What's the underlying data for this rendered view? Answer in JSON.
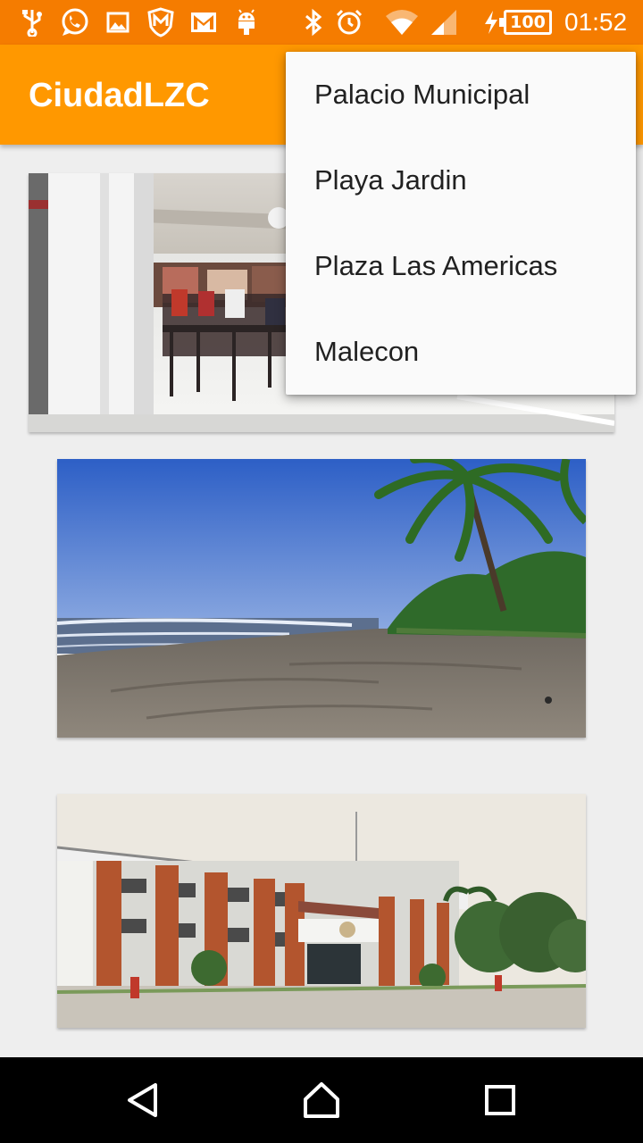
{
  "status_bar": {
    "icons": [
      "usb-icon",
      "whatsapp-icon",
      "image-icon",
      "shield-m-icon",
      "gmail-icon",
      "android-icon",
      "bluetooth-icon",
      "alarm-icon",
      "wifi-icon",
      "signal-icon",
      "charging-icon"
    ],
    "battery": "100",
    "time": "01:52",
    "color": "#f57c00"
  },
  "app_bar": {
    "title": "CiudadLZC",
    "color": "#ff9800"
  },
  "menu": {
    "items": [
      "Palacio Municipal",
      "Playa Jardin",
      "Plaza Las Americas",
      "Malecon"
    ]
  },
  "cards": [
    "cafe-photo",
    "beach-photo",
    "palacio-photo"
  ],
  "nav_bar": {
    "buttons": [
      "back-icon",
      "home-icon",
      "recents-icon"
    ]
  }
}
